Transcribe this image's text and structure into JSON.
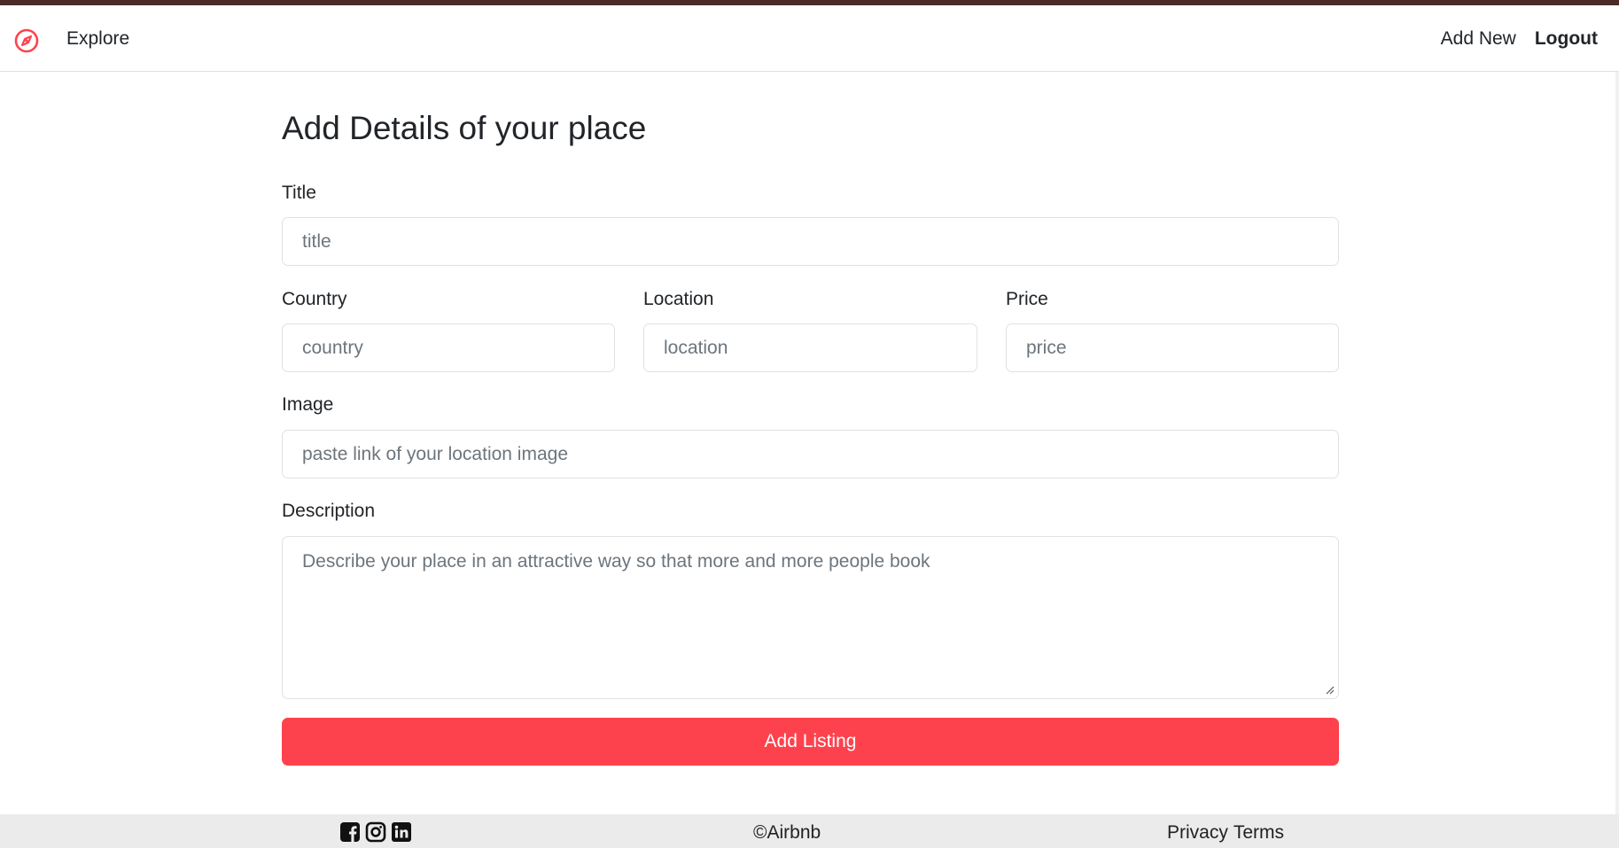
{
  "nav": {
    "brand_icon": "compass-icon",
    "explore_label": "Explore",
    "add_new_label": "Add New",
    "logout_label": "Logout"
  },
  "form": {
    "heading": "Add Details of your place",
    "title_label": "Title",
    "title_placeholder": "title",
    "country_label": "Country",
    "country_placeholder": "country",
    "location_label": "Location",
    "location_placeholder": "location",
    "price_label": "Price",
    "price_placeholder": "price",
    "image_label": "Image",
    "image_placeholder": "paste link of your location image",
    "description_label": "Description",
    "description_placeholder": "Describe your place in an attractive way so that more and more people book",
    "submit_label": "Add Listing"
  },
  "footer": {
    "social_icons": [
      "facebook-icon",
      "instagram-icon",
      "linkedin-icon"
    ],
    "copyright": "©Airbnb",
    "privacy_label": "Privacy",
    "terms_label": "Terms"
  },
  "colors": {
    "accent": "#fe424d",
    "top_stripe": "#4a2b26",
    "footer_bg": "#ebebeb"
  }
}
